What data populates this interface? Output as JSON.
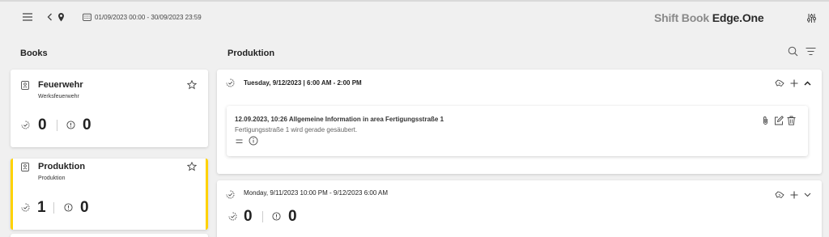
{
  "header": {
    "date_range": "01/09/2023 00:00 - 30/09/2023 23:59",
    "brand_light": "Shift Book",
    "brand_bold": "Edge.One"
  },
  "books_panel": {
    "title": "Books",
    "books": [
      {
        "title": "Feuerwehr",
        "subtitle": "Werksfeuerwehr",
        "done_count": "0",
        "info_count": "0"
      },
      {
        "title": "Produktion",
        "subtitle": "Produktion",
        "done_count": "1",
        "info_count": "0"
      }
    ]
  },
  "main": {
    "title": "Produktion",
    "shifts": [
      {
        "title": "Tuesday, 9/12/2023 | 6:00 AM - 2:00 PM",
        "entry": {
          "title": "12.09.2023, 10:26 Allgemeine Information in area Fertigungsstraße 1",
          "body": "Fertigungsstraße 1 wird gerade gesäubert."
        }
      },
      {
        "title": "Monday, 9/11/2023 10:00 PM - 9/12/2023 6:00 AM",
        "done_count": "0",
        "info_count": "0"
      }
    ]
  },
  "colors": {
    "accent": "#ffd200"
  }
}
